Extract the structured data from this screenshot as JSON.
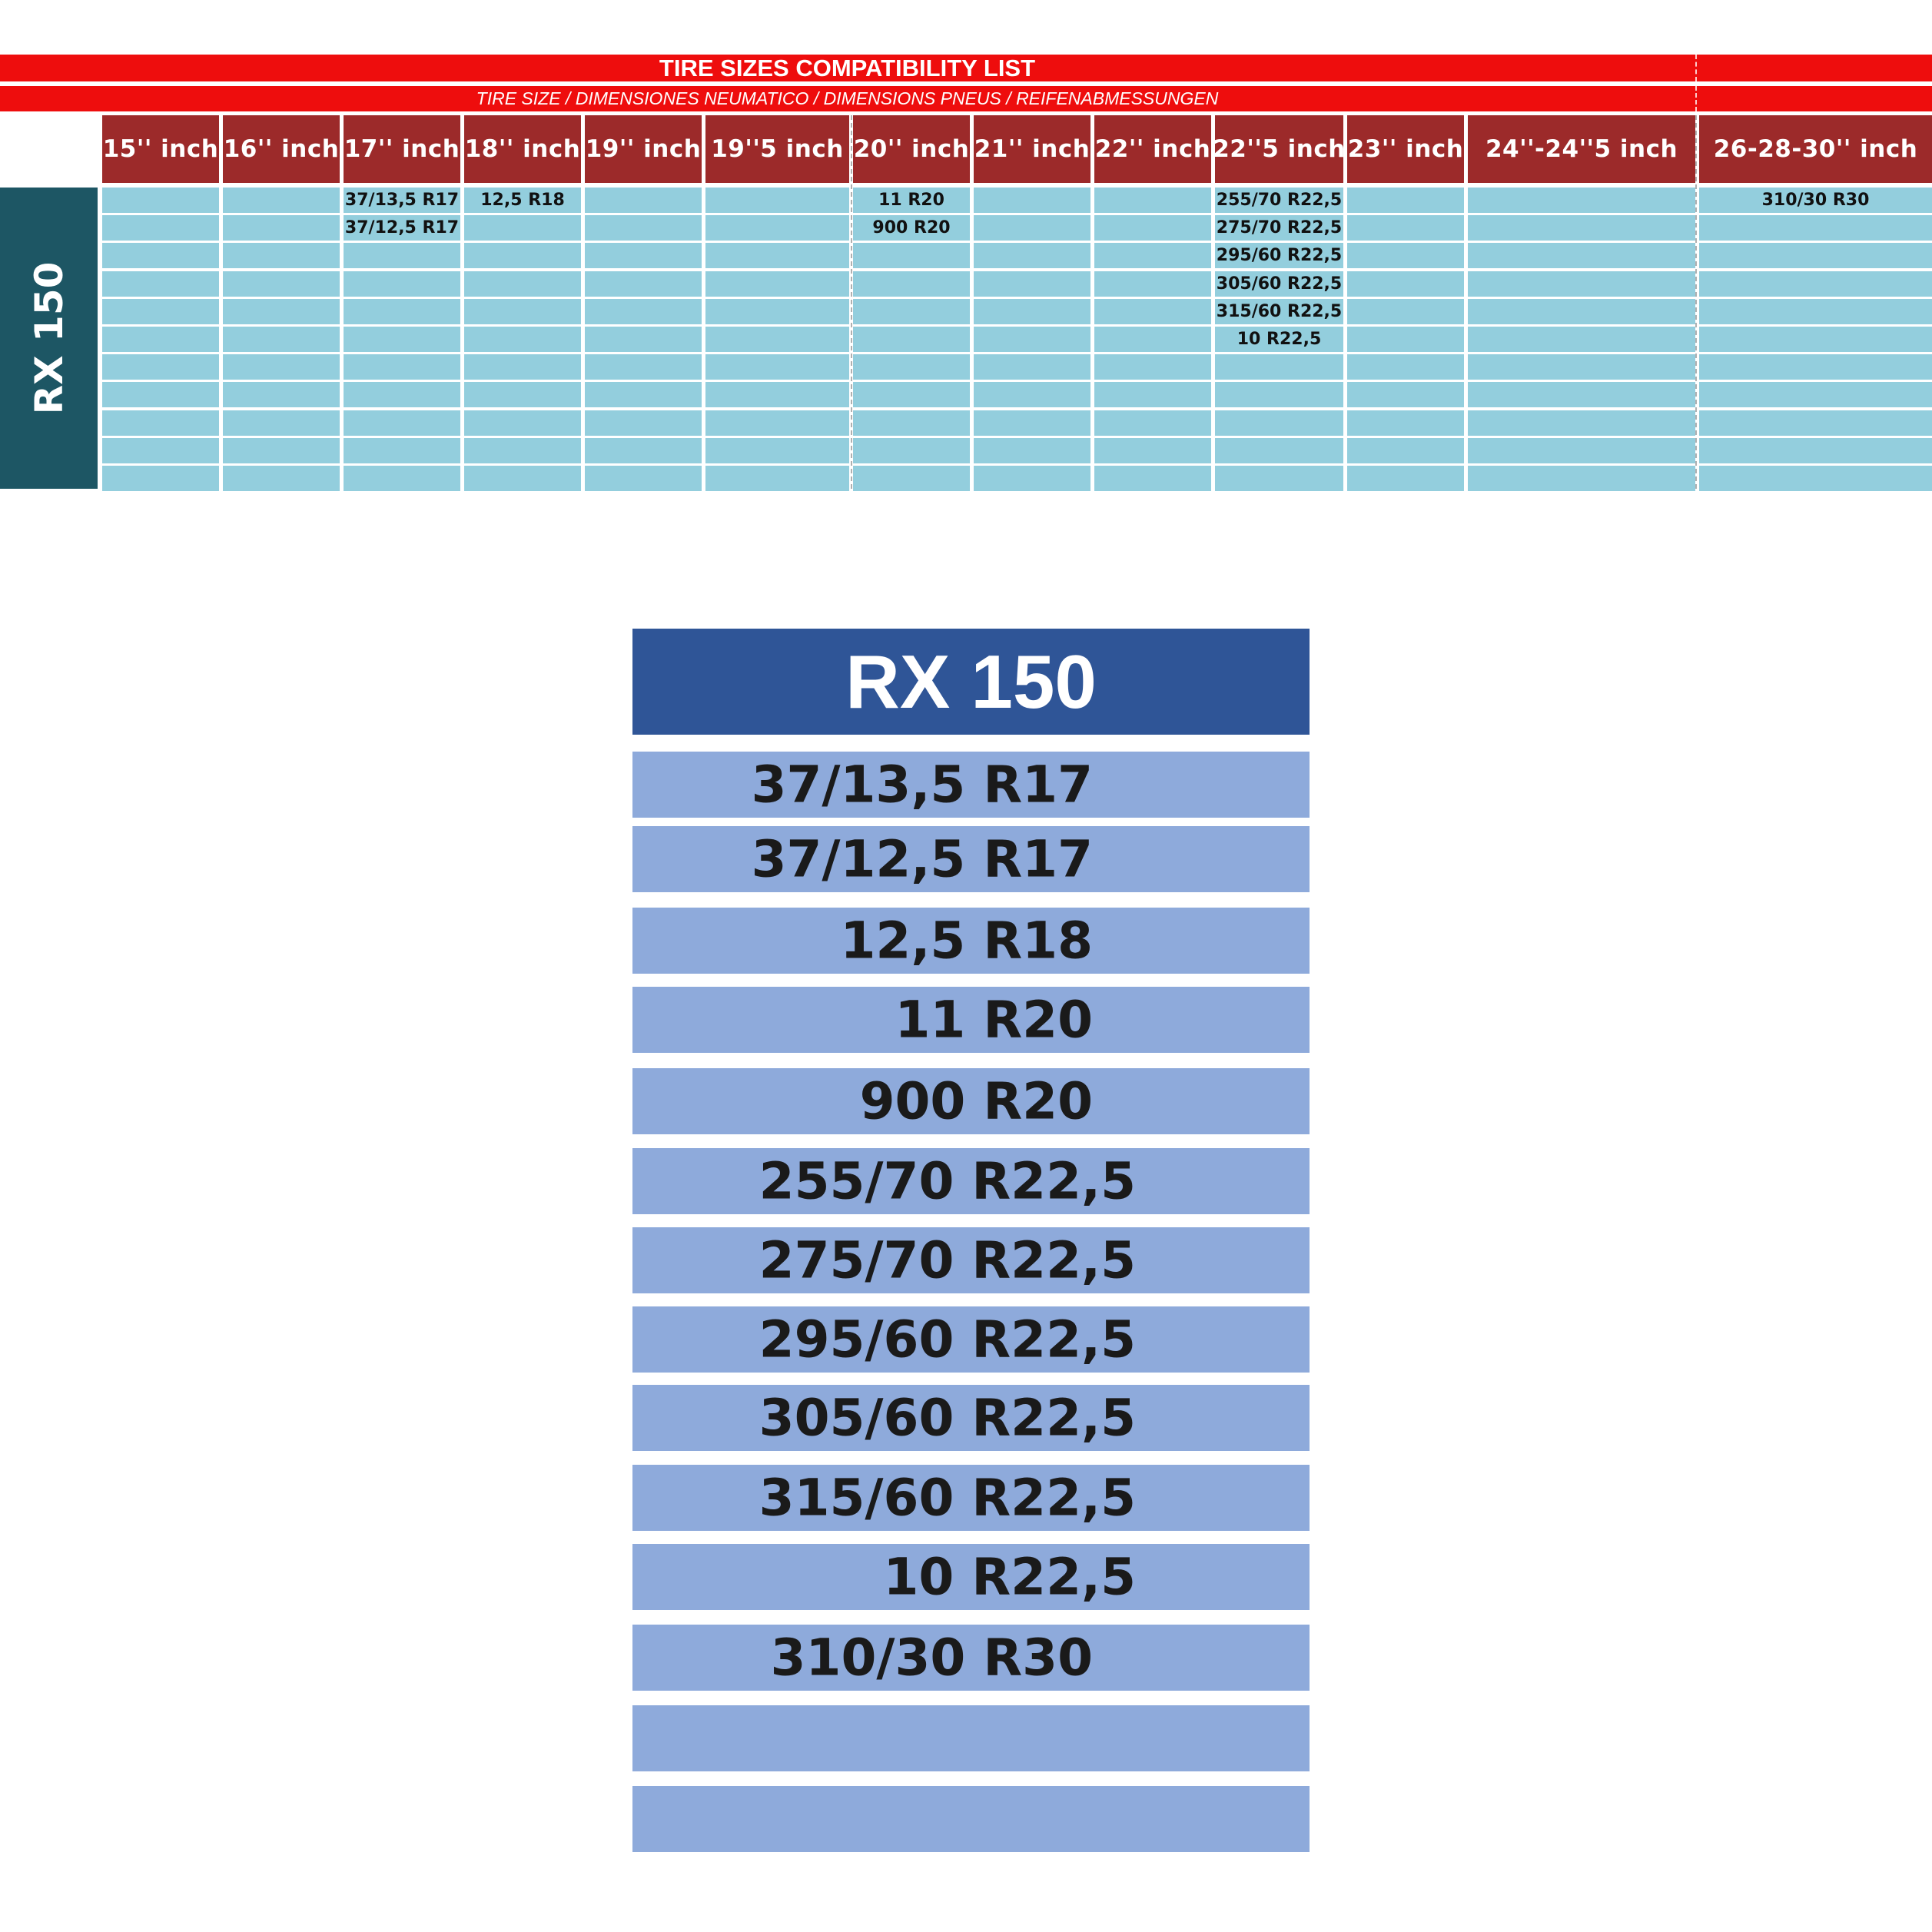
{
  "sheet": {
    "title": "TIRE SIZES COMPATIBILITY LIST",
    "subtitle": "TIRE SIZE  /  DIMENSIONES NEUMATICO  /  DIMENSIONS PNEUS  /  REIFENABMESSUNGEN",
    "model": "RX 150",
    "columns": [
      "15'' inch",
      "16'' inch",
      "17'' inch",
      "18'' inch",
      "19'' inch",
      "19''5 inch",
      "20'' inch",
      "21'' inch",
      "22'' inch",
      "22''5 inch",
      "23'' inch",
      "24''-24''5 inch",
      "26-28-30'' inch"
    ],
    "rows": [
      [
        "",
        "",
        "37/13,5 R17",
        "12,5 R18",
        "",
        "",
        "11 R20",
        "",
        "",
        "255/70 R22,5",
        "",
        "",
        "310/30 R30"
      ],
      [
        "",
        "",
        "37/12,5 R17",
        "",
        "",
        "",
        "900 R20",
        "",
        "",
        "275/70 R22,5",
        "",
        "",
        ""
      ],
      [
        "",
        "",
        "",
        "",
        "",
        "",
        "",
        "",
        "",
        "295/60 R22,5",
        "",
        "",
        ""
      ],
      [
        "",
        "",
        "",
        "",
        "",
        "",
        "",
        "",
        "",
        "305/60 R22,5",
        "",
        "",
        ""
      ],
      [
        "",
        "",
        "",
        "",
        "",
        "",
        "",
        "",
        "",
        "315/60 R22,5",
        "",
        "",
        ""
      ],
      [
        "",
        "",
        "",
        "",
        "",
        "",
        "",
        "",
        "",
        "10 R22,5",
        "",
        "",
        ""
      ],
      [
        "",
        "",
        "",
        "",
        "",
        "",
        "",
        "",
        "",
        "",
        "",
        "",
        ""
      ],
      [
        "",
        "",
        "",
        "",
        "",
        "",
        "",
        "",
        "",
        "",
        "",
        "",
        ""
      ],
      [
        "",
        "",
        "",
        "",
        "",
        "",
        "",
        "",
        "",
        "",
        "",
        "",
        ""
      ],
      [
        "",
        "",
        "",
        "",
        "",
        "",
        "",
        "",
        "",
        "",
        "",
        "",
        ""
      ],
      [
        "",
        "",
        "",
        "",
        "",
        "",
        "",
        "",
        "",
        "",
        "",
        "",
        ""
      ]
    ]
  },
  "zoom": {
    "title": "RX 150",
    "items": [
      "37/13,5 R17",
      "37/12,5 R17",
      "12,5 R18",
      "11 R20",
      "900 R20",
      "255/70 R22,5",
      "275/70 R22,5",
      "295/60 R22,5",
      "305/60 R22,5",
      "315/60 R22,5",
      "10 R22,5",
      "310/30 R30",
      "",
      ""
    ]
  },
  "colors": {
    "title_band": "#ee0d0d",
    "header_cell": "#9c2a2a",
    "side_label": "#1d5664",
    "grid_cell": "#93cedd",
    "zoom_header": "#2f5597",
    "zoom_row": "#8eaadb"
  }
}
